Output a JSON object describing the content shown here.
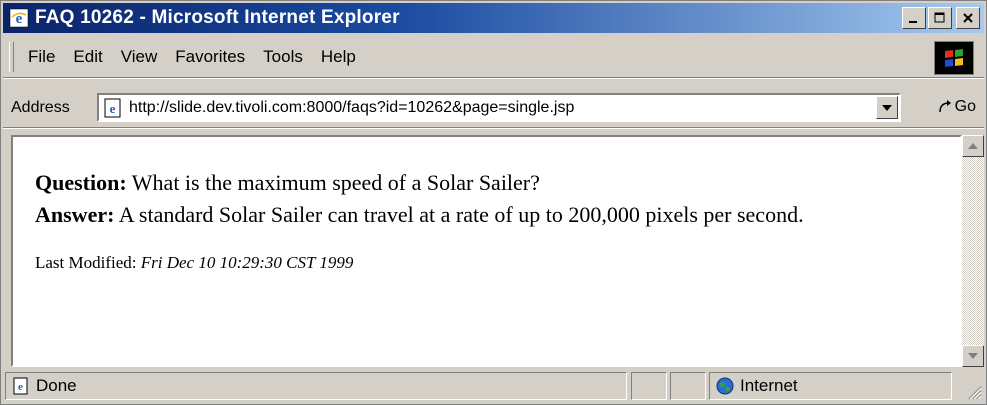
{
  "window": {
    "title": "FAQ 10262 - Microsoft Internet Explorer",
    "controls": {
      "minimize": "_",
      "maximize": "□",
      "close": "×"
    }
  },
  "menubar": {
    "items": [
      {
        "label": "File"
      },
      {
        "label": "Edit"
      },
      {
        "label": "View"
      },
      {
        "label": "Favorites"
      },
      {
        "label": "Tools"
      },
      {
        "label": "Help"
      }
    ]
  },
  "addressbar": {
    "label": "Address",
    "url": "http://slide.dev.tivoli.com:8000/faqs?id=10262&page=single.jsp",
    "go_label": "Go"
  },
  "content": {
    "question_label": "Question:",
    "question_text": " What is the maximum speed of a Solar Sailer?",
    "answer_label": "Answer:",
    "answer_text": " A standard Solar Sailer can travel at a rate of up to 200,000 pixels per second.",
    "modified_label": "Last Modified: ",
    "modified_value": "Fri Dec 10 10:29:30 CST 1999"
  },
  "statusbar": {
    "status": "Done",
    "zone": "Internet"
  },
  "icons": {
    "ie": "ie-logo-icon",
    "page": "page-icon",
    "go": "go-arrow-icon",
    "globe": "globe-icon",
    "windows_flag": "windows-flag-icon"
  },
  "colors": {
    "titlebar_start": "#0a246a",
    "titlebar_end": "#a6caf0",
    "chrome": "#d4d0c8"
  }
}
